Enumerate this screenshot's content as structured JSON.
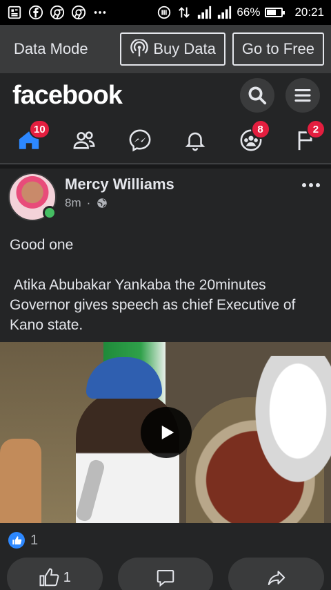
{
  "status": {
    "battery_text": "66%",
    "battery_level": 0.66,
    "time": "20:21",
    "left_icons": [
      "news-icon",
      "facebook-icon",
      "chrome-icon",
      "chrome-icon",
      "more-dots-icon",
      "sync-icon"
    ]
  },
  "databar": {
    "mode_label": "Data Mode",
    "buy_label": "Buy Data",
    "free_label": "Go to Free"
  },
  "header": {
    "logo": "facebook"
  },
  "tabs": [
    {
      "name": "home",
      "badge": "10"
    },
    {
      "name": "friends",
      "badge": ""
    },
    {
      "name": "messenger",
      "badge": ""
    },
    {
      "name": "notifications",
      "badge": ""
    },
    {
      "name": "groups",
      "badge": "8"
    },
    {
      "name": "pages",
      "badge": "2"
    }
  ],
  "post": {
    "author": "Mercy Williams",
    "time": "8m",
    "separator": "·",
    "text_line1": "Good one",
    "text_line2": " Atika Abubakar Yankaba the 20minutes Governor gives speech as chief Executive of Kano state.",
    "reaction_count": "1",
    "like_count": "1"
  },
  "colors": {
    "accent": "#2d88ff",
    "badge": "#e41e3f",
    "online": "#45bd62"
  }
}
